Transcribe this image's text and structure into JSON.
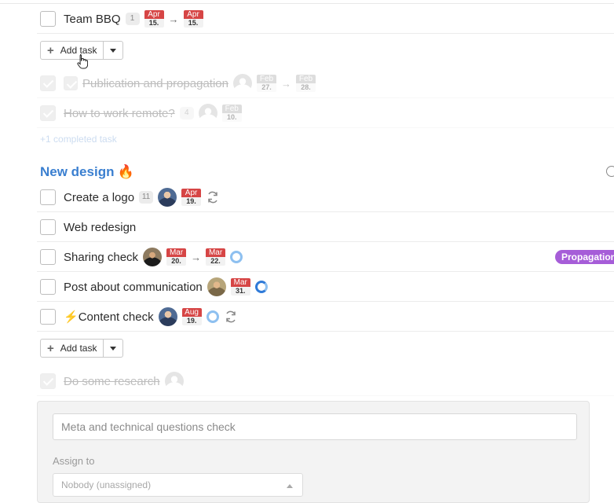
{
  "group_one": {
    "tasks": [
      {
        "title": "Team BBQ",
        "count": "1",
        "date_from": {
          "m": "Apr",
          "d": "15."
        },
        "date_to": {
          "m": "Apr",
          "d": "15."
        },
        "done": false
      },
      {
        "title": "Publication and propagation",
        "date_from": {
          "m": "Feb",
          "d": "27."
        },
        "date_to": {
          "m": "Feb",
          "d": "28."
        },
        "done": true
      },
      {
        "title": "How to work remote?",
        "count": "4",
        "date_to": {
          "m": "Feb",
          "d": "10."
        },
        "done": true
      }
    ],
    "add_task_label": "Add task",
    "completed_link": "+1 completed task"
  },
  "section": {
    "title": "New design",
    "emoji": "🔥"
  },
  "group_two": {
    "tasks": [
      {
        "title": "Create a logo",
        "count": "11",
        "date": {
          "m": "Apr",
          "d": "19."
        },
        "repeat": true
      },
      {
        "title": "Web redesign"
      },
      {
        "title": "Sharing check",
        "date_from": {
          "m": "Mar",
          "d": "20."
        },
        "date_to": {
          "m": "Mar",
          "d": "22."
        },
        "progress": 0.0,
        "tag": "Propagation"
      },
      {
        "title": "Post about communication",
        "date": {
          "m": "Mar",
          "d": "31."
        },
        "progress": 0.75
      },
      {
        "title": "Content check",
        "prefix_icon": "⚡",
        "date": {
          "m": "Aug",
          "d": "19."
        },
        "progress": 0.0,
        "repeat": true
      }
    ],
    "add_task_label": "Add task",
    "completed_task": {
      "title": "Do some research",
      "done": true
    }
  },
  "editor": {
    "title_placeholder": "Meta and technical questions check",
    "assign_label": "Assign to",
    "assign_value": "Nobody (unassigned)"
  },
  "colors": {
    "accent": "#3a7fd0",
    "tag": "#a65dd8",
    "date_red": "#d64545"
  }
}
